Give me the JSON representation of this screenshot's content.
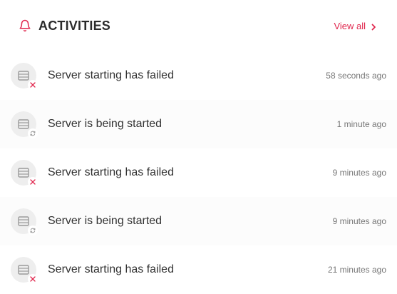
{
  "header": {
    "title": "ACTIVITIES",
    "view_all_label": "View all",
    "accent_color": "#e0264d",
    "icon": "bell-icon"
  },
  "activities": [
    {
      "message": "Server starting has failed",
      "time": "58 seconds ago",
      "status": "failed",
      "status_icon": "close-icon"
    },
    {
      "message": "Server is being started",
      "time": "1 minute ago",
      "status": "starting",
      "status_icon": "refresh-icon"
    },
    {
      "message": "Server starting has failed",
      "time": "9 minutes ago",
      "status": "failed",
      "status_icon": "close-icon"
    },
    {
      "message": "Server is being started",
      "time": "9 minutes ago",
      "status": "starting",
      "status_icon": "refresh-icon"
    },
    {
      "message": "Server starting has failed",
      "time": "21 minutes ago",
      "status": "failed",
      "status_icon": "close-icon"
    }
  ]
}
